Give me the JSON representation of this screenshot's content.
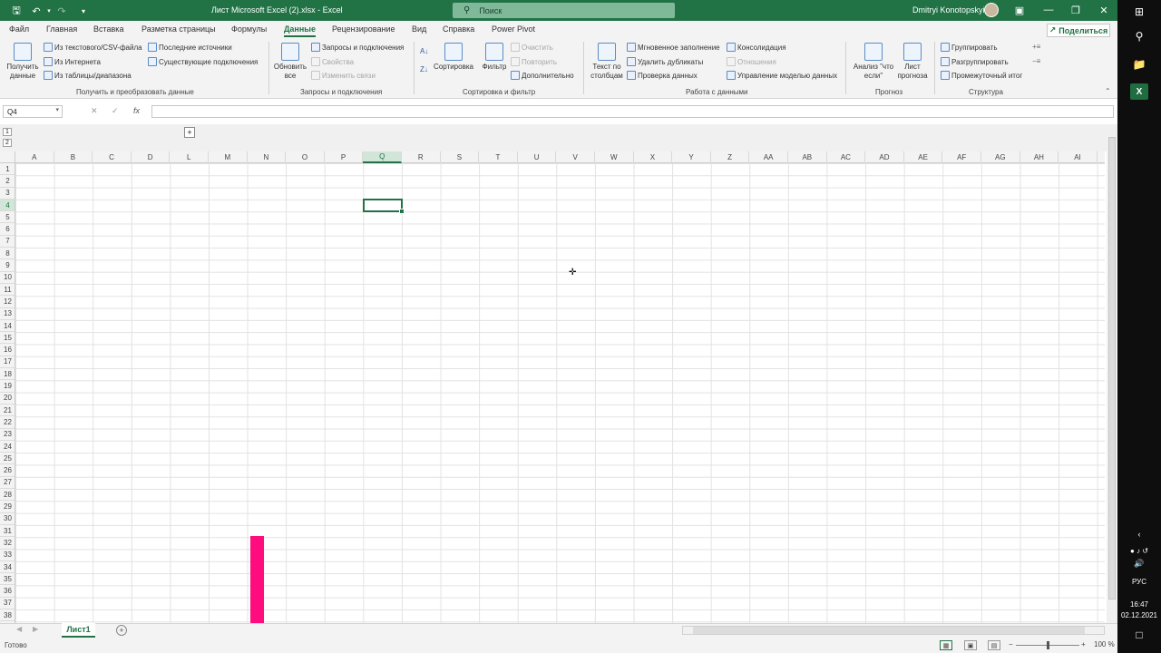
{
  "titlebar": {
    "doc_title": "Лист Microsoft Excel (2).xlsx  -  Excel",
    "search_placeholder": "Поиск",
    "user_name": "Dmitryi Konotopskyi"
  },
  "tabs": [
    "Файл",
    "Главная",
    "Вставка",
    "Разметка страницы",
    "Формулы",
    "Данные",
    "Рецензирование",
    "Вид",
    "Справка",
    "Power Pivot"
  ],
  "active_tab": "Данные",
  "share_label": "Поделиться",
  "ribbon": {
    "get_data": "Получить данные",
    "from_text_csv": "Из текстового/CSV-файла",
    "from_web": "Из Интернета",
    "from_table": "Из таблицы/диапазона",
    "recent_sources": "Последние источники",
    "existing_connections": "Существующие подключения",
    "group_get_transform": "Получить и преобразовать данные",
    "refresh_all": "Обновить все",
    "queries_connections": "Запросы и подключения",
    "properties": "Свойства",
    "edit_links": "Изменить связи",
    "group_queries": "Запросы и подключения",
    "sort": "Сортировка",
    "filter": "Фильтр",
    "clear": "Очистить",
    "reapply": "Повторить",
    "advanced": "Дополнительно",
    "group_sort_filter": "Сортировка и фильтр",
    "text_to_columns": "Текст по столбцам",
    "flash_fill": "Мгновенное заполнение",
    "remove_duplicates": "Удалить дубликаты",
    "data_validation": "Проверка данных",
    "consolidate": "Консолидация",
    "relationships": "Отношения",
    "manage_data_model": "Управление моделью данных",
    "group_data_tools": "Работа с данными",
    "what_if": "Анализ \"что если\"",
    "forecast_sheet": "Лист прогноза",
    "group_forecast": "Прогноз",
    "group": "Группировать",
    "ungroup": "Разгруппировать",
    "subtotal": "Промежуточный итог",
    "group_outline": "Структура"
  },
  "formula_bar": {
    "name_box": "Q4",
    "fx": "fx"
  },
  "outline_levels": [
    "1",
    "2"
  ],
  "columns": [
    "A",
    "B",
    "C",
    "D",
    "L",
    "M",
    "N",
    "O",
    "P",
    "Q",
    "R",
    "S",
    "T",
    "U",
    "V",
    "W",
    "X",
    "Y",
    "Z",
    "AA",
    "AB",
    "AC",
    "AD",
    "AE",
    "AF",
    "AG",
    "AH",
    "AI"
  ],
  "selected_column": "Q",
  "rows": [
    "1",
    "2",
    "3",
    "4",
    "5",
    "6",
    "7",
    "8",
    "9",
    "10",
    "11",
    "12",
    "13",
    "14",
    "15",
    "16",
    "17",
    "18",
    "19",
    "20",
    "21",
    "22",
    "23",
    "24",
    "25",
    "26",
    "27",
    "28",
    "29",
    "30",
    "31",
    "32",
    "33",
    "34",
    "35",
    "36",
    "37",
    "38"
  ],
  "selected_row": "4",
  "sheet_tab": "Лист1",
  "status": "Готово",
  "zoom": "100 %",
  "taskbar": {
    "lang": "РУС",
    "time": "16:47",
    "date": "02.12.2021"
  },
  "colors": {
    "accent": "#217346",
    "highlight": "#ff0c7f"
  }
}
